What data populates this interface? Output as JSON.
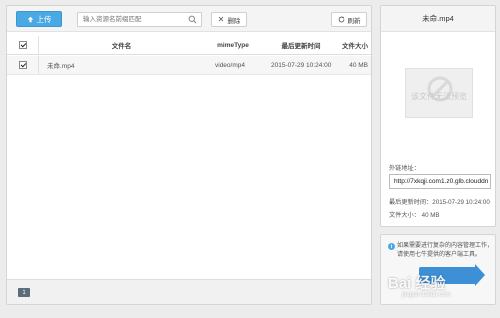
{
  "toolbar": {
    "upload_label": "上传",
    "search_placeholder": "输入资源名前缀匹配",
    "delete_label": "删除",
    "refresh_label": "刷新"
  },
  "table": {
    "columns": [
      "文件名",
      "mimeType",
      "最后更新时间",
      "文件大小"
    ],
    "rows": [
      {
        "name": "未命.mp4",
        "mime": "video/mp4",
        "time": "2015-07-29 10:24:00",
        "size": "40 MB"
      }
    ]
  },
  "pagination": {
    "current": "1"
  },
  "detail": {
    "title": "未命.mp4",
    "preview_text": "该文件无法预览",
    "url_label": "外链地址：",
    "url_value": "http://7xkqji.com1.z0.glb.clouddn",
    "updated_label": "最后更新时间：2015-07-29 10:24:00",
    "size_label": "文件大小：  40 MB"
  },
  "info": {
    "text": "如果需要进行复杂的内容管理工作，请使用七牛提供的客户端工具。"
  },
  "watermark": {
    "main": "Bai 经验",
    "sub": "jingyan.baidu.com"
  },
  "colors": {
    "accent": "#4aa9e3",
    "page_badge": "#5a6b7a"
  }
}
